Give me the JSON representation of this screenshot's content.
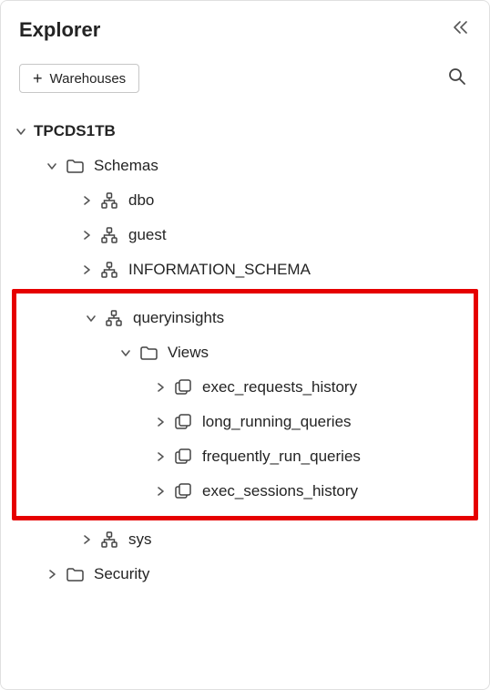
{
  "header": {
    "title": "Explorer"
  },
  "toolbar": {
    "warehouses_label": "Warehouses"
  },
  "tree": {
    "database": {
      "name": "TPCDS1TB"
    },
    "schemas_folder": {
      "label": "Schemas"
    },
    "schemas": {
      "dbo": {
        "name": "dbo"
      },
      "guest": {
        "name": "guest"
      },
      "information_schema": {
        "name": "INFORMATION_SCHEMA"
      },
      "queryinsights": {
        "name": "queryinsights",
        "views_folder_label": "Views",
        "views": {
          "exec_requests_history": {
            "name": "exec_requests_history"
          },
          "long_running_queries": {
            "name": "long_running_queries"
          },
          "frequently_run_queries": {
            "name": "frequently_run_queries"
          },
          "exec_sessions_history": {
            "name": "exec_sessions_history"
          }
        }
      },
      "sys": {
        "name": "sys"
      }
    },
    "security_folder": {
      "label": "Security"
    }
  }
}
